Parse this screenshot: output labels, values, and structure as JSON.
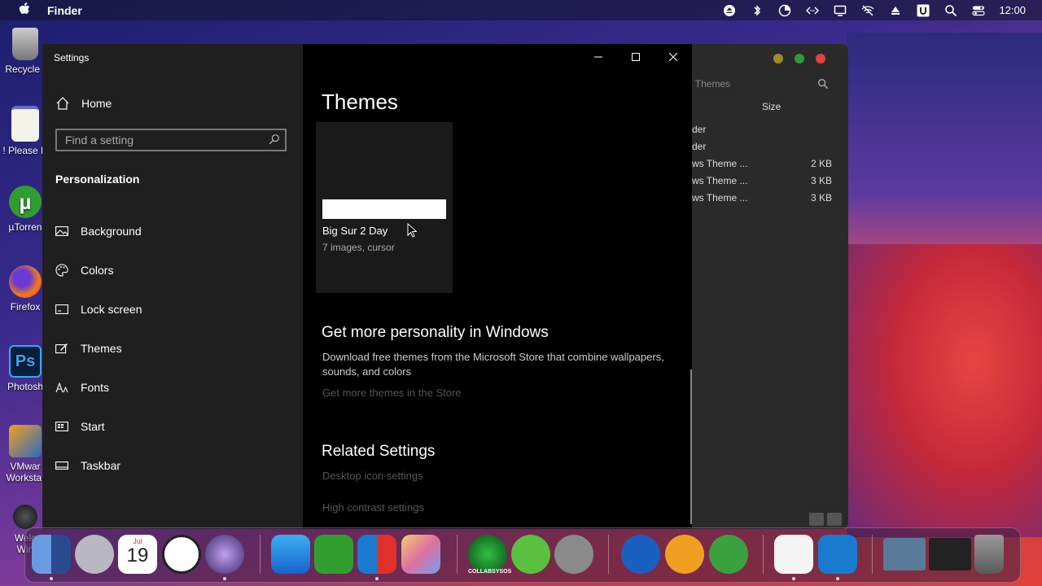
{
  "menubar": {
    "app_name": "Finder",
    "clock": "12:00",
    "status_icons": [
      "eject-icon",
      "bluetooth-icon",
      "timer-icon",
      "code-icon",
      "display-icon",
      "wifi-off-icon",
      "triangle-up-icon",
      "u-icon",
      "search-icon",
      "control-center-icon"
    ]
  },
  "desktop_icons": [
    {
      "label": "Recycle I",
      "icon": "recycle-bin-icon"
    },
    {
      "label": "! Please R",
      "icon": "notepad-icon"
    },
    {
      "label": "µTorren",
      "icon": "utorrent-icon"
    },
    {
      "label": "Firefox",
      "icon": "firefox-icon"
    },
    {
      "label": "Photosh",
      "icon": "photoshop-icon"
    },
    {
      "label": "VMwar",
      "label2": "Workstat",
      "icon": "vmware-icon"
    },
    {
      "label": "Welc",
      "label2": "Win",
      "icon": "apple-logo-icon"
    }
  ],
  "finder": {
    "search_placeholder": "rch Themes",
    "column_size": "Size",
    "rows": [
      {
        "name": "der",
        "size": ""
      },
      {
        "name": "der",
        "size": ""
      },
      {
        "name": "ws Theme ...",
        "size": "2 KB"
      },
      {
        "name": "ws Theme ...",
        "size": "3 KB"
      },
      {
        "name": "ws Theme ...",
        "size": "3 KB"
      }
    ]
  },
  "settings": {
    "window_title": "Settings",
    "home_label": "Home",
    "search_placeholder": "Find a setting",
    "section_title": "Personalization",
    "nav": [
      {
        "label": "Background",
        "icon": "picture-icon"
      },
      {
        "label": "Colors",
        "icon": "palette-icon"
      },
      {
        "label": "Lock screen",
        "icon": "lock-screen-icon"
      },
      {
        "label": "Themes",
        "icon": "themes-brush-icon"
      },
      {
        "label": "Fonts",
        "icon": "fonts-icon"
      },
      {
        "label": "Start",
        "icon": "start-icon"
      },
      {
        "label": "Taskbar",
        "icon": "taskbar-icon"
      }
    ],
    "main": {
      "title": "Themes",
      "theme": {
        "name": "Big Sur 2 Day",
        "meta": "7 images, cursor"
      },
      "more_heading": "Get more personality in Windows",
      "more_text": "Download free themes from the Microsoft Store that combine wallpapers, sounds, and colors",
      "more_link": "Get more themes in the Store",
      "related_heading": "Related Settings",
      "related_links": [
        "Desktop icon settings",
        "High contrast settings"
      ]
    }
  },
  "dock": {
    "calendar_month": "Jul",
    "calendar_day": "19",
    "collabsysos_label": "COLLABSYSOS",
    "apps": [
      "finder-icon",
      "launchpad-rocket-icon",
      "calendar-icon",
      "clock-icon",
      "siri-icon",
      "safari-icon",
      "utorrent-icon",
      "windows-logo-icon",
      "photo-viewer-icon",
      "collabsysos-icon",
      "link-icon",
      "tools-icon",
      "www-globe-icon",
      "download-arrow-icon",
      "network-people-icon",
      "textedit-icon",
      "settings-gear-icon",
      "window-preview-1",
      "window-preview-2",
      "trash-icon"
    ]
  },
  "colors": {
    "finder_close": "#e0443e",
    "finder_min": "#a08a2a",
    "finder_max": "#2f9a3a"
  }
}
